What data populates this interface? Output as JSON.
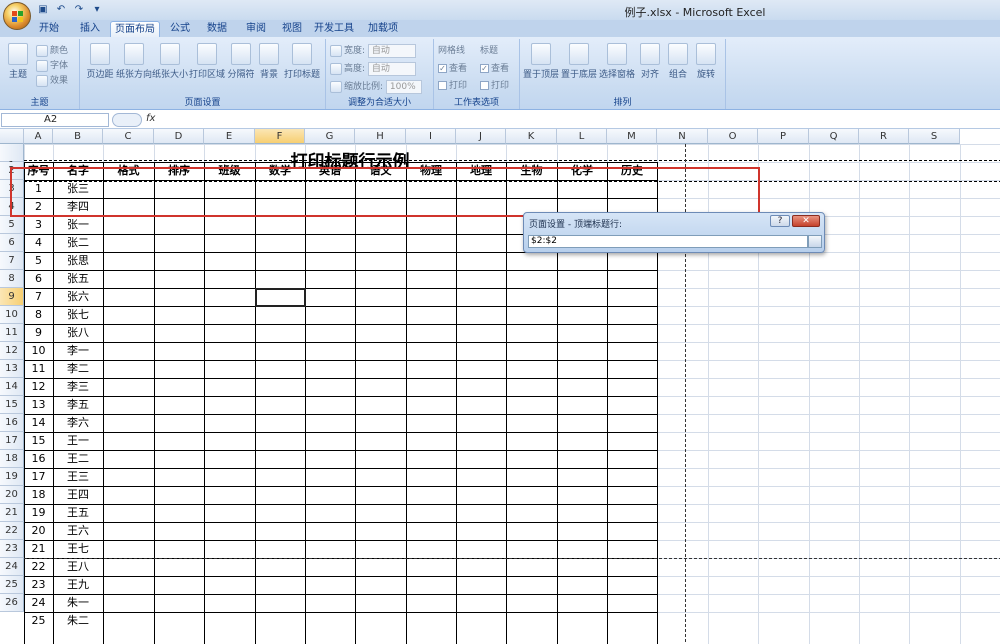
{
  "window": {
    "title": "例子.xlsx - Microsoft Excel"
  },
  "qat": {
    "save_icon": "save-icon",
    "undo_icon": "undo-icon",
    "redo_icon": "redo-icon"
  },
  "tabs": [
    "开始",
    "插入",
    "页面布局",
    "公式",
    "数据",
    "审阅",
    "视图",
    "开发工具",
    "加载项"
  ],
  "active_tab": "页面布局",
  "ribbon": {
    "theme": {
      "label": "主题",
      "colors": "颜色",
      "fonts": "字体",
      "effects": "效果",
      "group": "主题"
    },
    "page_setup": {
      "margins": "页边距",
      "orientation": "纸张方向",
      "size": "纸张大小",
      "print_area": "打印区域",
      "breaks": "分隔符",
      "background": "背景",
      "print_titles": "打印标题",
      "group": "页面设置"
    },
    "scale": {
      "width": "宽度:",
      "width_val": "自动",
      "height": "高度:",
      "height_val": "自动",
      "scale": "缩放比例:",
      "scale_val": "100%",
      "group": "调整为合适大小"
    },
    "sheet_options": {
      "gridlines": "网格线",
      "headings": "标题",
      "view1": "查看",
      "print1": "打印",
      "view2": "查看",
      "print2": "打印",
      "group": "工作表选项"
    },
    "arrange": {
      "front": "置于顶层",
      "back": "置于底层",
      "pane": "选择窗格",
      "align": "对齐",
      "groupbtn": "组合",
      "rotate": "旋转",
      "group": "排列"
    }
  },
  "namebox": "A2",
  "fx": "fx",
  "columns": [
    "A",
    "B",
    "C",
    "D",
    "E",
    "F",
    "G",
    "H",
    "I",
    "J",
    "K",
    "L",
    "M",
    "N",
    "O",
    "P",
    "Q",
    "R",
    "S"
  ],
  "selected_column": "F",
  "sheet_title": "打印标题行示例",
  "headers": [
    "序号",
    "名字",
    "格式",
    "排序",
    "班级",
    "数学",
    "英语",
    "语文",
    "物理",
    "地理",
    "生物",
    "化学",
    "历史"
  ],
  "rows": [
    [
      "1",
      "张三"
    ],
    [
      "2",
      "李四"
    ],
    [
      "3",
      "张一"
    ],
    [
      "4",
      "张二"
    ],
    [
      "5",
      "张思"
    ],
    [
      "6",
      "张五"
    ],
    [
      "7",
      "张六"
    ],
    [
      "8",
      "张七"
    ],
    [
      "9",
      "张八"
    ],
    [
      "10",
      "李一"
    ],
    [
      "11",
      "李二"
    ],
    [
      "12",
      "李三"
    ],
    [
      "13",
      "李五"
    ],
    [
      "14",
      "李六"
    ],
    [
      "15",
      "王一"
    ],
    [
      "16",
      "王二"
    ],
    [
      "17",
      "王三"
    ],
    [
      "18",
      "王四"
    ],
    [
      "19",
      "王五"
    ],
    [
      "20",
      "王六"
    ],
    [
      "21",
      "王七"
    ],
    [
      "22",
      "王八"
    ],
    [
      "23",
      "王九"
    ],
    [
      "24",
      "朱一"
    ],
    [
      "25",
      "朱二"
    ]
  ],
  "row_numbers": [
    "1",
    "2",
    "3",
    "4",
    "5",
    "6",
    "7",
    "8",
    "9",
    "10",
    "11",
    "12",
    "13",
    "14",
    "15",
    "16",
    "17",
    "18",
    "19",
    "20",
    "21",
    "22",
    "23",
    "24",
    "25",
    "26"
  ],
  "selected_row": "9",
  "dialog": {
    "title": "页面设置 - 顶端标题行:",
    "value": "$2:$2",
    "help": "?",
    "close": "✕"
  }
}
